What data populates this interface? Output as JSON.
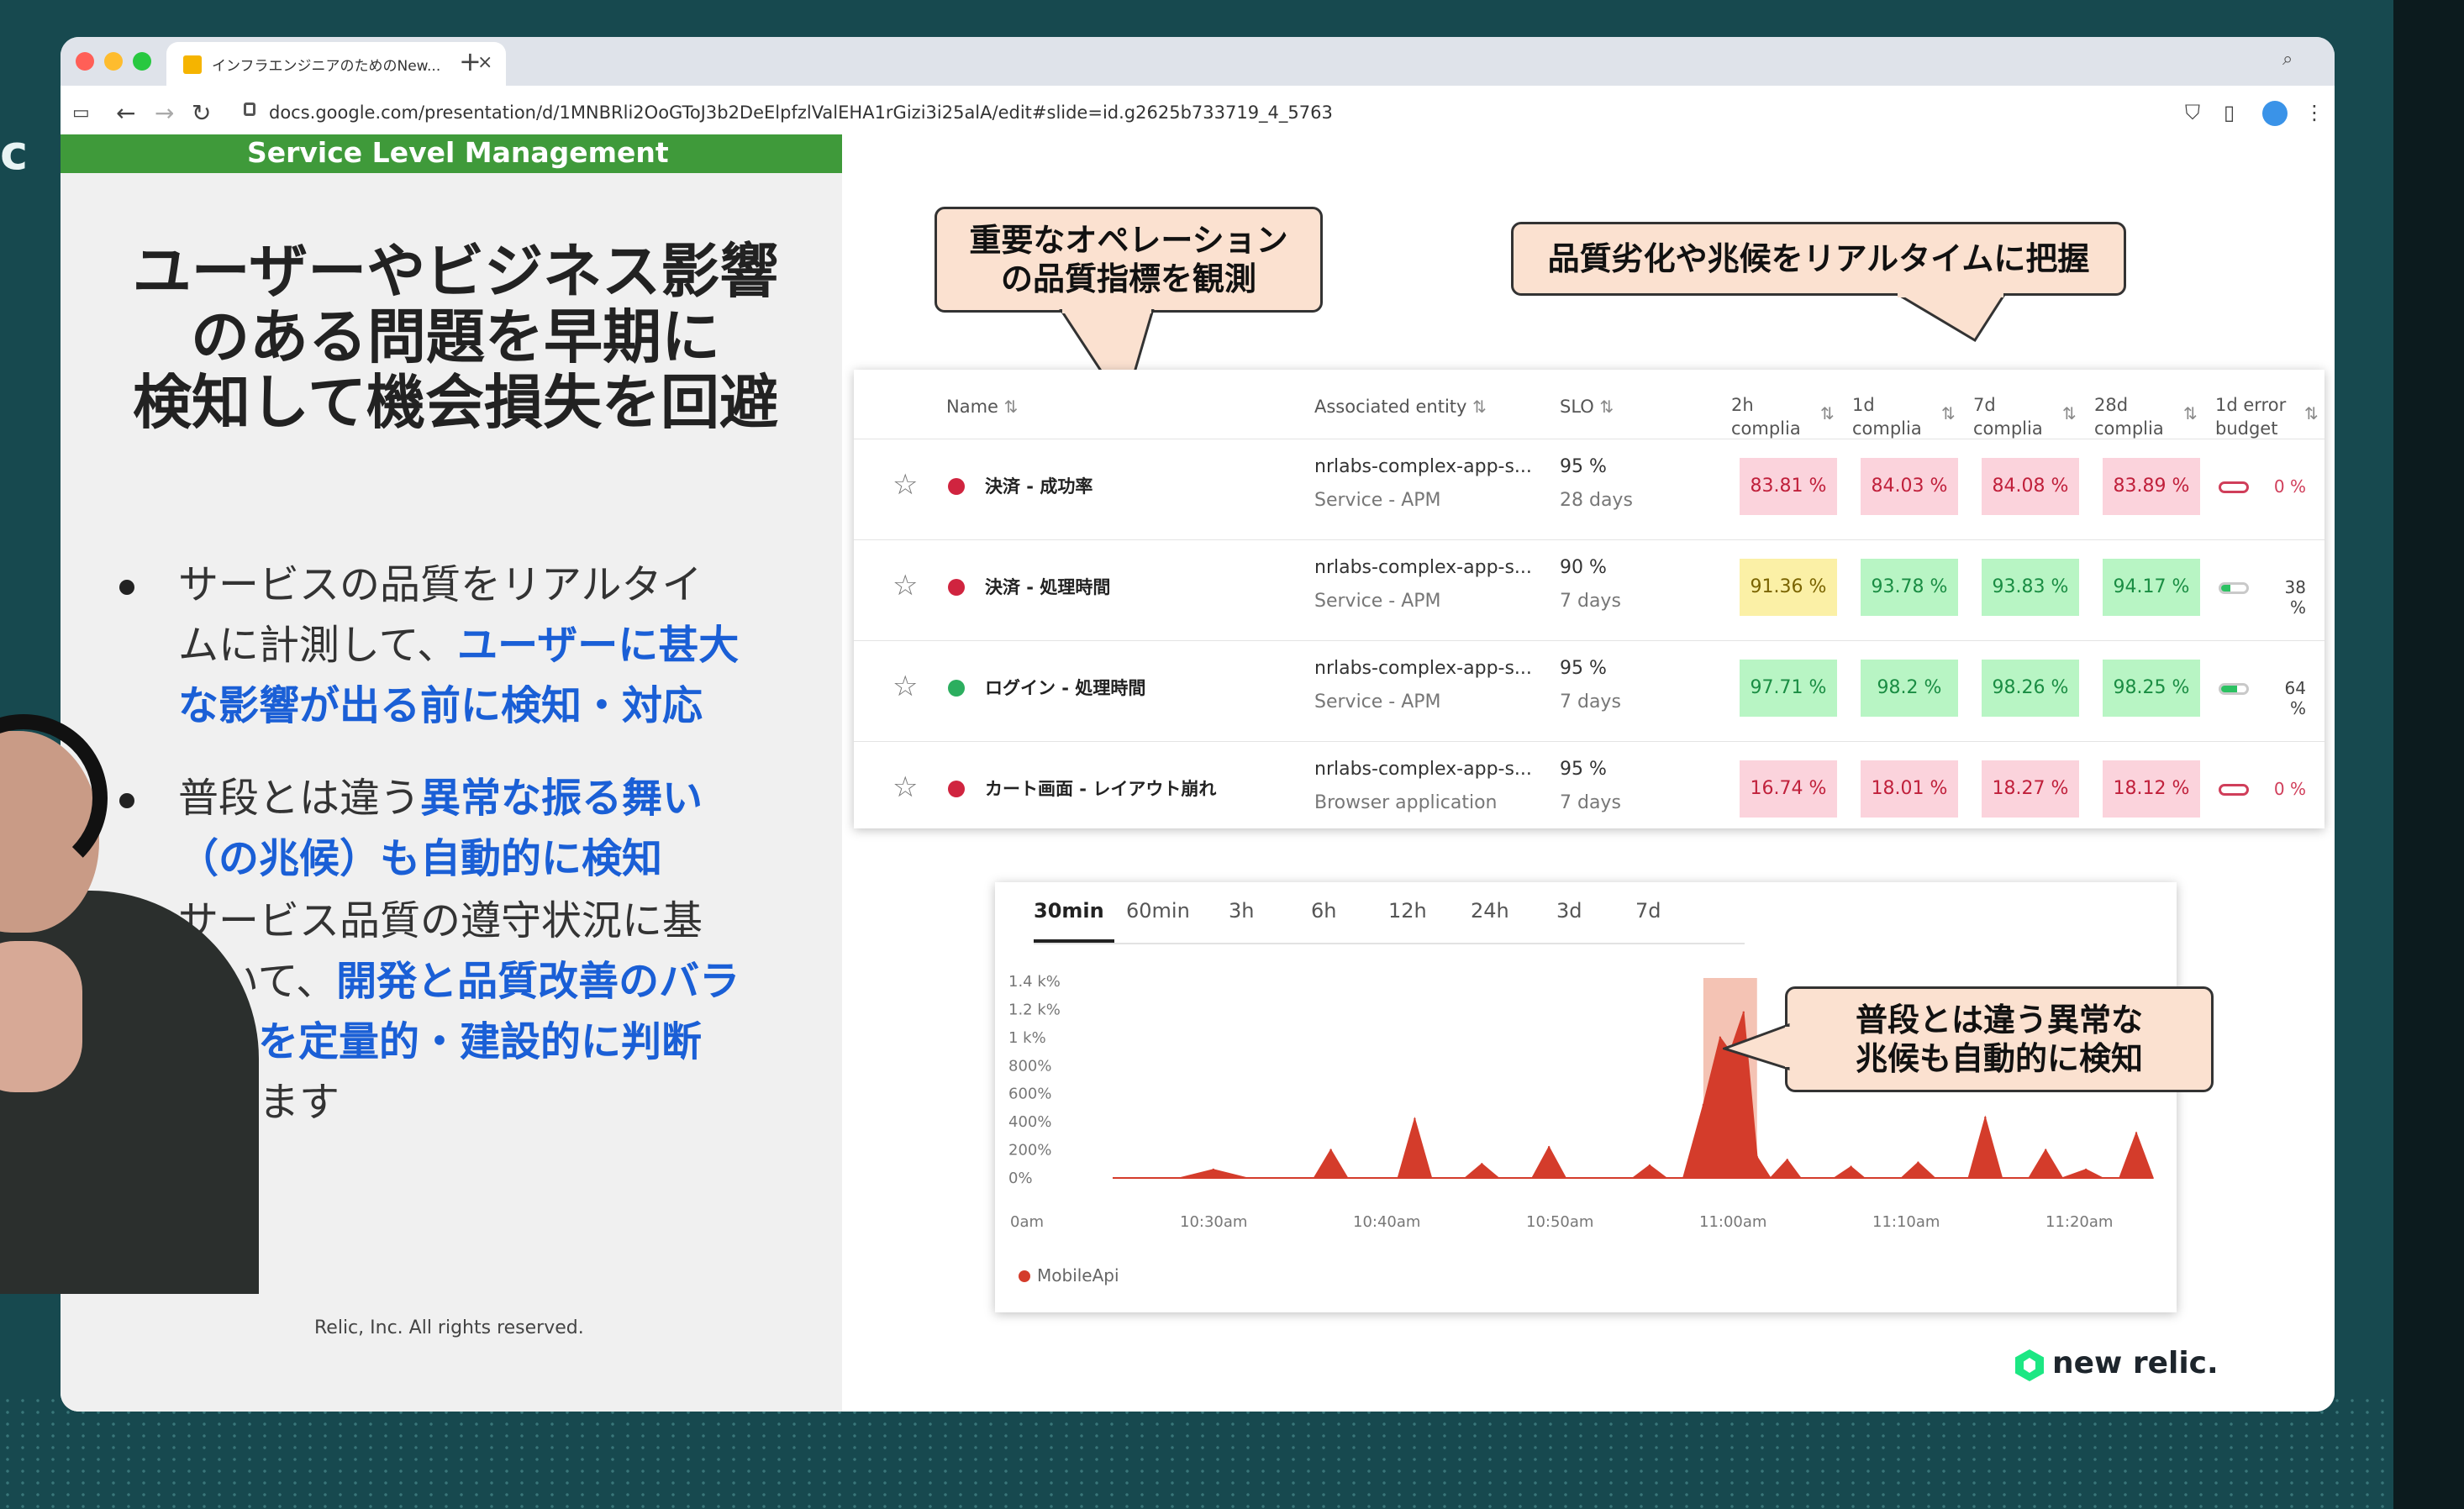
{
  "browser": {
    "tab_title": "インフラエンジニアのためのNew...",
    "url": "docs.google.com/presentation/d/1MNBRli2OoGToJ3b2DeElpfzlValEHA1rGizi3i25alA/edit#slide=id.g2625b733719_4_5763",
    "icons": [
      "sidebar-icon",
      "back-icon",
      "forward-icon",
      "reload-icon",
      "lock-icon",
      "shield-icon",
      "reader-icon",
      "extension-icon",
      "menu-icon",
      "search-icon"
    ]
  },
  "slide": {
    "section_title": "Service Level Management",
    "headline": [
      "ユーザーやビジネス影響",
      "のある問題を早期に",
      "検知して機会損失を回避"
    ],
    "bullets": [
      {
        "lines": [
          [
            "サービスの品質をリアルタイ"
          ],
          [
            "ムに計測して、",
            "ユーザーに甚大"
          ],
          [
            "な影響が出る前に検知・対応"
          ]
        ]
      },
      {
        "lines": [
          [
            "普段とは違う",
            "異常な振る舞い"
          ],
          [
            "（の兆候）も自動的に検知"
          ]
        ]
      },
      {
        "lines": [
          [
            "サービス品質の遵守状況に基"
          ],
          [
            "づいて、",
            "開発と品質改善のバラ"
          ],
          [
            "ンスを定量的・建設的に判断"
          ],
          [
            "できます"
          ]
        ]
      }
    ],
    "copyright": "Relic, Inc. All rights reserved.",
    "callout_ops": [
      "重要なオペレーション",
      "の品質指標を観測"
    ],
    "callout_realtime": "品質劣化や兆候をリアルタイムに把握",
    "callout_anomaly": [
      "普段とは違う異常な",
      "兆候も自動的に検知"
    ],
    "brand": "new relic."
  },
  "table": {
    "headers": {
      "name": "Name",
      "entity": "Associated entity",
      "slo": "SLO",
      "c2h": [
        "2h",
        "complia"
      ],
      "c1d": [
        "1d",
        "complia"
      ],
      "c7d": [
        "7d",
        "complia"
      ],
      "c28d": [
        "28d",
        "complia"
      ],
      "budget": [
        "1d error",
        "budget"
      ]
    },
    "rows": [
      {
        "name": "決済 - 成功率",
        "status_color": "#d0243f",
        "entity": "nrlabs-complex-app-s...",
        "entity_type": "Service - APM",
        "slo": "95 %",
        "period": "28 days",
        "c2h": "83.81 %",
        "c1d": "84.03 %",
        "c7d": "84.08 %",
        "c28d": "83.89 %",
        "c2h_state": "red",
        "c1d_state": "red",
        "c7d_state": "red",
        "c28d_state": "red",
        "budget": "0 %",
        "budget_fraction": 0.0
      },
      {
        "name": "決済 - 処理時間",
        "status_color": "#d0243f",
        "entity": "nrlabs-complex-app-s...",
        "entity_type": "Service - APM",
        "slo": "90 %",
        "period": "7 days",
        "c2h": "91.36 %",
        "c1d": "93.78 %",
        "c7d": "93.83 %",
        "c28d": "94.17 %",
        "c2h_state": "yellow",
        "c1d_state": "green",
        "c7d_state": "green",
        "c28d_state": "green",
        "budget": "38 %",
        "budget_fraction": 0.38
      },
      {
        "name": "ログイン - 処理時間",
        "status_color": "#2cae5f",
        "entity": "nrlabs-complex-app-s...",
        "entity_type": "Service - APM",
        "slo": "95 %",
        "period": "7 days",
        "c2h": "97.71 %",
        "c1d": "98.2 %",
        "c7d": "98.26 %",
        "c28d": "98.25 %",
        "c2h_state": "green",
        "c1d_state": "green",
        "c7d_state": "green",
        "c28d_state": "green",
        "budget": "64 %",
        "budget_fraction": 0.64
      },
      {
        "name": "カート画面 - レイアウト崩れ",
        "status_color": "#d0243f",
        "entity": "nrlabs-complex-app-s...",
        "entity_type": "Browser application",
        "slo": "95 %",
        "period": "7 days",
        "c2h": "16.74 %",
        "c1d": "18.01 %",
        "c7d": "18.27 %",
        "c28d": "18.12 %",
        "c2h_state": "red",
        "c1d_state": "red",
        "c7d_state": "red",
        "c28d_state": "red",
        "budget": "0 %",
        "budget_fraction": 0.0
      }
    ]
  },
  "time_range": {
    "tabs": [
      "30min",
      "60min",
      "3h",
      "6h",
      "12h",
      "24h",
      "3d",
      "7d"
    ],
    "selected": "30min"
  },
  "chart_data": {
    "type": "area",
    "x_tick_labels": [
      "0am",
      "10:30am",
      "10:40am",
      "10:50am",
      "11:00am",
      "11:10am",
      "11:20am"
    ],
    "y_tick_labels": [
      "1.4 k%",
      "1.2 k%",
      "1 k%",
      "800%",
      "600%",
      "400%",
      "200%",
      "0%"
    ],
    "ylim": [
      0,
      1400
    ],
    "x_minutes_range": [
      0,
      31
    ],
    "series": [
      {
        "name": "MobileApi",
        "color": "#d43c2b",
        "points": [
          [
            0,
            0
          ],
          [
            2.0,
            0
          ],
          [
            3.0,
            60
          ],
          [
            4.0,
            0
          ],
          [
            5.0,
            0
          ],
          [
            6.0,
            0
          ],
          [
            6.5,
            200
          ],
          [
            7.0,
            0
          ],
          [
            8.5,
            0
          ],
          [
            9.0,
            420
          ],
          [
            9.5,
            0
          ],
          [
            10.5,
            0
          ],
          [
            11.0,
            100
          ],
          [
            11.5,
            0
          ],
          [
            12.5,
            0
          ],
          [
            13.0,
            220
          ],
          [
            13.5,
            0
          ],
          [
            15.5,
            0
          ],
          [
            16.0,
            90
          ],
          [
            16.5,
            0
          ],
          [
            17.0,
            0
          ],
          [
            17.6,
            520
          ],
          [
            18.1,
            1000
          ],
          [
            18.4,
            900
          ],
          [
            18.8,
            1180
          ],
          [
            19.2,
            150
          ],
          [
            19.6,
            0
          ],
          [
            20.1,
            130
          ],
          [
            20.5,
            0
          ],
          [
            21.5,
            0
          ],
          [
            22.0,
            80
          ],
          [
            22.4,
            0
          ],
          [
            23.5,
            0
          ],
          [
            24.0,
            110
          ],
          [
            24.5,
            0
          ],
          [
            25.5,
            0
          ],
          [
            26.0,
            430
          ],
          [
            26.5,
            0
          ],
          [
            27.3,
            0
          ],
          [
            27.8,
            200
          ],
          [
            28.3,
            0
          ],
          [
            29.0,
            60
          ],
          [
            29.5,
            0
          ],
          [
            30.0,
            0
          ],
          [
            30.5,
            320
          ],
          [
            31,
            0
          ]
        ]
      }
    ],
    "highlight_window_minutes": [
      17.6,
      19.2
    ],
    "legend": "bottom-left"
  }
}
